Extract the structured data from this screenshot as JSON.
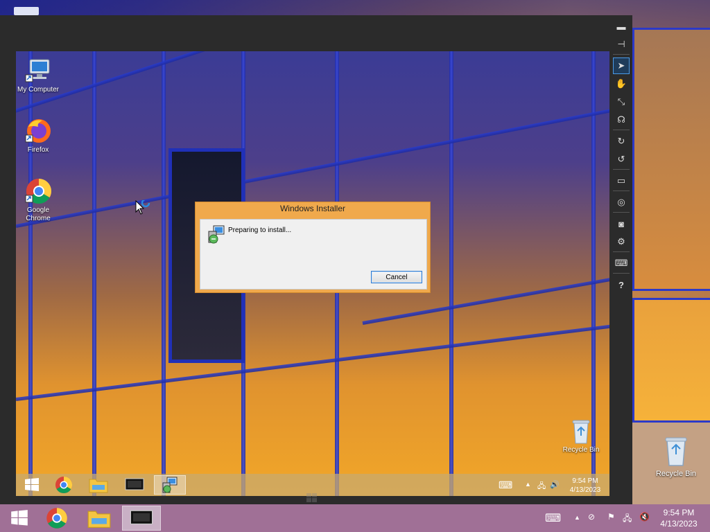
{
  "remote_desktop": {
    "icons": [
      {
        "label": "My Computer",
        "icon": "computer-icon"
      },
      {
        "label": "Firefox",
        "icon": "firefox-icon"
      },
      {
        "label": "Google Chrome",
        "icon": "chrome-icon"
      },
      {
        "label": "Recycle Bin",
        "icon": "recycle-bin-icon"
      }
    ],
    "taskbar": {
      "apps": [
        "start-icon",
        "chrome-icon",
        "file-explorer-icon",
        "remote-desktop-icon",
        "installer-icon"
      ],
      "clock_time": "9:54 PM",
      "clock_date": "4/13/2023"
    }
  },
  "dialog": {
    "title": "Windows Installer",
    "message": "Preparing to install...",
    "cancel_label": "Cancel"
  },
  "viewer_toolbar": {
    "items": [
      "minimize-icon",
      "pin-icon",
      "pointer-icon",
      "hand-icon",
      "fit-icon",
      "headphones-icon",
      "refresh-icon",
      "rotate-icon",
      "monitor-icon",
      "globe-icon",
      "camera-icon",
      "settings-icon",
      "keyboard-icon",
      "help-icon"
    ],
    "help_glyph": "?"
  },
  "host_desktop": {
    "recycle_bin_label": "Recycle Bin",
    "taskbar": {
      "apps": [
        "start-icon",
        "chrome-icon",
        "file-explorer-icon",
        "remote-desktop-icon"
      ],
      "clock_time": "9:54 PM",
      "clock_date": "4/13/2023"
    }
  },
  "colors": {
    "accent_orange": "#f0a94c",
    "host_taskbar": "#a07096",
    "viewer_frame": "#2b2b2b"
  }
}
